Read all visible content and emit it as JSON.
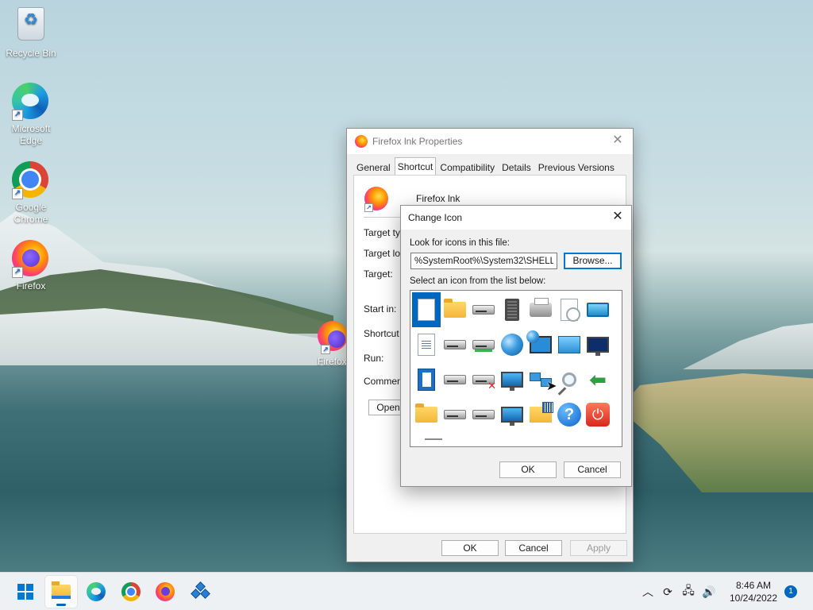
{
  "desktop": {
    "icons": [
      {
        "label": "Recycle Bin"
      },
      {
        "label": "Microsoft Edge"
      },
      {
        "label": "Google Chrome"
      },
      {
        "label": "Firefox"
      }
    ],
    "overlap_label": "Firefox"
  },
  "properties": {
    "title": "Firefox lnk Properties",
    "tabs": [
      "General",
      "Shortcut",
      "Compatibility",
      "Details",
      "Previous Versions"
    ],
    "active_tab": "Shortcut",
    "shortcut_name": "Firefox lnk",
    "fields": [
      "Target typ",
      "Target loc",
      "Target:",
      "Start in:",
      "Shortcut k",
      "Run:",
      "Commen"
    ],
    "open_label": "Open",
    "ok_label": "OK",
    "cancel_label": "Cancel",
    "apply_label": "Apply"
  },
  "change_icon": {
    "title": "Change Icon",
    "look_for_label": "Look for icons in this file:",
    "path_value": "%SystemRoot%\\System32\\SHELL32.dll",
    "browse_label": "Browse...",
    "select_label": "Select an icon from the list below:",
    "ok_label": "OK",
    "cancel_label": "Cancel",
    "icons": [
      "blank-document-icon",
      "folder-icon",
      "drive-icon",
      "memory-chip-icon",
      "printer-icon",
      "clock-document-icon",
      "network-card-icon",
      "shortcut-partial-icon",
      "text-document-icon",
      "floppy-drive-icon",
      "green-drive-icon",
      "globe-icon",
      "globe-monitor-icon",
      "control-panel-monitor-icon",
      "sleep-monitor-icon",
      "shortcut-partial-icon",
      "blue-window-icon",
      "floppy-drive-icon",
      "drive-error-icon",
      "globe-network-icon",
      "network-icon",
      "search-icon",
      "green-arrow-icon",
      "box-partial-icon",
      "folder-icon",
      "drive-icon",
      "cd-drive-icon",
      "monitor-icon",
      "folder-grid-icon",
      "help-icon",
      "power-icon",
      "partial-icon"
    ]
  },
  "taskbar": {
    "time": "8:46 AM",
    "date": "10/24/2022",
    "notification_count": "1"
  }
}
